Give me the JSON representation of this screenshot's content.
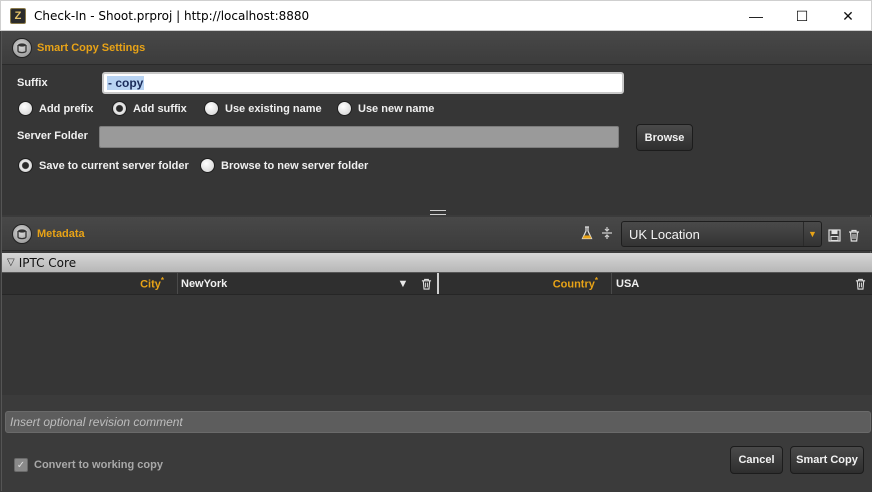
{
  "window": {
    "title": "Check-In - Shoot.prproj | http://localhost:8880",
    "app_icon_letter": "Z",
    "minimize_glyph": "—",
    "maximize_glyph": "☐",
    "close_glyph": "✕"
  },
  "smart_copy_settings": {
    "title": "Smart Copy Settings",
    "suffix_label": "Suffix",
    "suffix_value": "- copy",
    "naming_options": [
      {
        "label": "Add prefix",
        "checked": false
      },
      {
        "label": "Add suffix",
        "checked": true
      },
      {
        "label": "Use existing name",
        "checked": false
      },
      {
        "label": "Use new name",
        "checked": false
      }
    ],
    "server_folder_label": "Server Folder",
    "server_folder_value": "",
    "browse_label": "Browse",
    "folder_options": [
      {
        "label": "Save to current server folder",
        "checked": true
      },
      {
        "label": "Browse to new server folder",
        "checked": false
      }
    ]
  },
  "metadata": {
    "title": "Metadata",
    "preset_value": "UK Location",
    "group_title": "IPTC Core",
    "fields": [
      {
        "label": "City",
        "required_mark": "*",
        "value": "NewYork"
      },
      {
        "label": "Country",
        "required_mark": "*",
        "value": "USA"
      }
    ]
  },
  "footer": {
    "comment_placeholder": "Insert optional revision comment",
    "convert_label": "Convert to working copy",
    "convert_checked": true,
    "cancel_label": "Cancel",
    "smart_copy_label": "Smart Copy"
  },
  "colors": {
    "accent": "#e8a317",
    "panel_bg": "#363636",
    "header_bg": "#454545"
  }
}
